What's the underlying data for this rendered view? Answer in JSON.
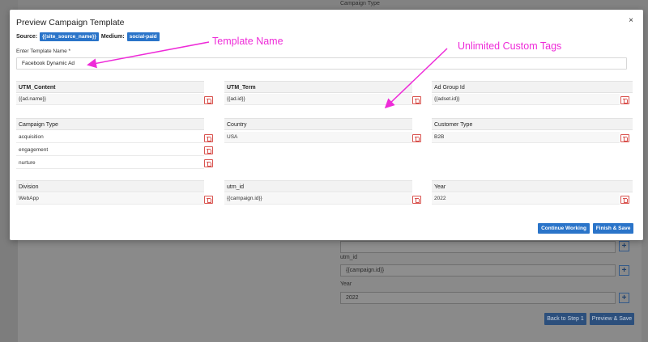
{
  "background": {
    "campaign_type_label": "Campaign Type",
    "utm_id_label": "utm_id",
    "utm_id_value": "{{campaign.id}}",
    "year_label": "Year",
    "year_value": "2022",
    "plus": "+",
    "back_button": "Back to Step 1",
    "preview_button": "Preview & Save"
  },
  "modal": {
    "title": "Preview Campaign Template",
    "close": "×",
    "source_label": "Source:",
    "source_value": "{{site_source_name}}",
    "medium_label": "Medium:",
    "medium_value": "social-paid",
    "template_name_label": "Enter Template Name *",
    "template_name_value": "Facebook Dynamic Ad",
    "annotations": {
      "template_name": "Template Name",
      "custom_tags": "Unlimited Custom Tags"
    },
    "columns": [
      {
        "header": "UTM_Content",
        "values": [
          "{{ad.name}}"
        ]
      },
      {
        "header": "UTM_Term",
        "values": [
          "{{ad.id}}"
        ]
      },
      {
        "header": "Ad Group Id",
        "values": [
          "{{adset.id}}"
        ]
      },
      {
        "header": "Campaign Type",
        "values": [
          "acquisition",
          "engagement",
          "nurture"
        ]
      },
      {
        "header": "Country",
        "values": [
          "USA"
        ]
      },
      {
        "header": "Customer Type",
        "values": [
          "B2B"
        ]
      },
      {
        "header": "Division",
        "values": [
          "WebApp"
        ]
      },
      {
        "header": "utm_id",
        "values": [
          "{{campaign.id}}"
        ]
      },
      {
        "header": "Year",
        "values": [
          "2022"
        ]
      }
    ],
    "continue_button": "Continue Working",
    "finish_button": "Finish & Save"
  },
  "colors": {
    "primary": "#2a74c9",
    "danger": "#d9534f",
    "annotation": "#ee2bd8"
  }
}
